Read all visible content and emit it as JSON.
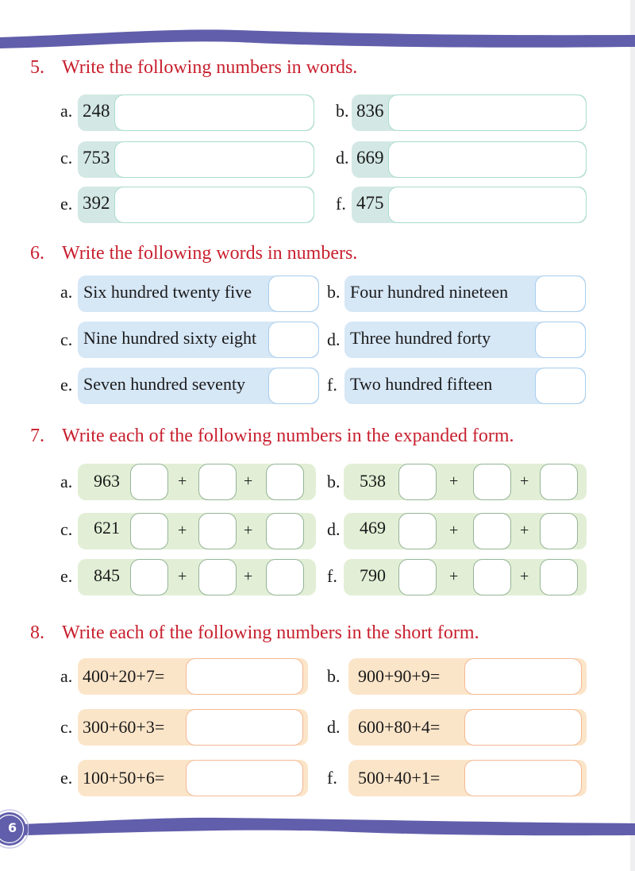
{
  "page": {
    "page_number": "6",
    "colors": {
      "band": "#615eab",
      "question_title": "#c8202e",
      "q5_bg": "#d3e8e4",
      "q6_bg": "#d6e7f6",
      "q7_bg": "#e2efd6",
      "q8_bg": "#fbe5c9"
    }
  },
  "q5": {
    "number": "5.",
    "title": "Write the following numbers in words.",
    "items": [
      {
        "label": "a.",
        "value": "248"
      },
      {
        "label": "b.",
        "value": "836"
      },
      {
        "label": "c.",
        "value": "753"
      },
      {
        "label": "d.",
        "value": "669"
      },
      {
        "label": "e.",
        "value": "392"
      },
      {
        "label": "f.",
        "value": "475"
      }
    ]
  },
  "q6": {
    "number": "6.",
    "title": "Write the following words in numbers.",
    "items": [
      {
        "label": "a.",
        "value": "Six hundred twenty five"
      },
      {
        "label": "b.",
        "value": "Four hundred nineteen"
      },
      {
        "label": "c.",
        "value": "Nine hundred sixty eight"
      },
      {
        "label": "d.",
        "value": "Three hundred forty"
      },
      {
        "label": "e.",
        "value": "Seven hundred seventy"
      },
      {
        "label": "f.",
        "value": "Two hundred fifteen"
      }
    ]
  },
  "q7": {
    "number": "7.",
    "title": "Write each of the following numbers in the expanded form.",
    "plus_sign": "+",
    "items": [
      {
        "label": "a.",
        "value": "963"
      },
      {
        "label": "b.",
        "value": "538"
      },
      {
        "label": "c.",
        "value": "621"
      },
      {
        "label": "d.",
        "value": "469"
      },
      {
        "label": "e.",
        "value": "845"
      },
      {
        "label": "f.",
        "value": "790"
      }
    ]
  },
  "q8": {
    "number": "8.",
    "title": "Write each of the following numbers in the short form.",
    "items": [
      {
        "label": "a.",
        "value": "400+20+7="
      },
      {
        "label": "b.",
        "value": "900+90+9="
      },
      {
        "label": "c.",
        "value": "300+60+3="
      },
      {
        "label": "d.",
        "value": "600+80+4="
      },
      {
        "label": "e.",
        "value": "100+50+6="
      },
      {
        "label": "f.",
        "value": "500+40+1="
      }
    ]
  }
}
